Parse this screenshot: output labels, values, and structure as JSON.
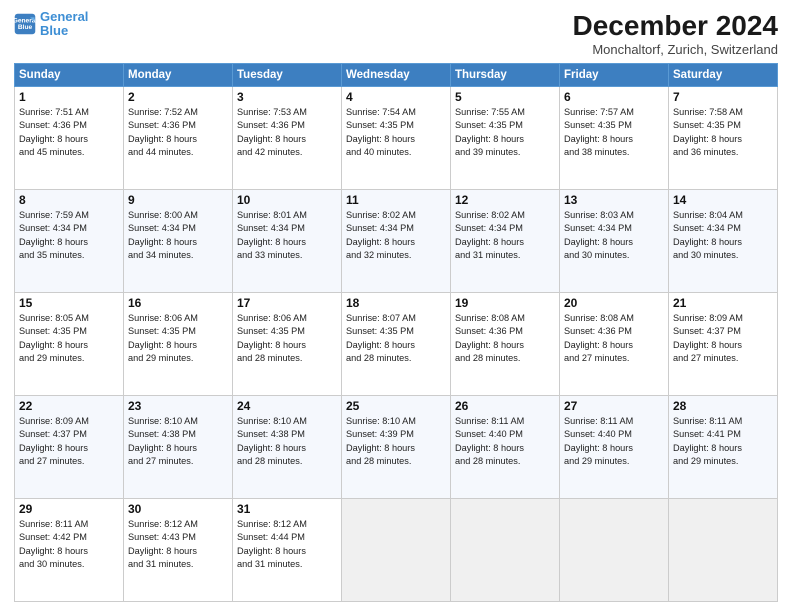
{
  "logo": {
    "line1": "General",
    "line2": "Blue"
  },
  "title": "December 2024",
  "location": "Monchaltorf, Zurich, Switzerland",
  "days_of_week": [
    "Sunday",
    "Monday",
    "Tuesday",
    "Wednesday",
    "Thursday",
    "Friday",
    "Saturday"
  ],
  "weeks": [
    [
      {
        "day": "1",
        "sunrise": "7:51 AM",
        "sunset": "4:36 PM",
        "daylight": "8 hours and 45 minutes."
      },
      {
        "day": "2",
        "sunrise": "7:52 AM",
        "sunset": "4:36 PM",
        "daylight": "8 hours and 44 minutes."
      },
      {
        "day": "3",
        "sunrise": "7:53 AM",
        "sunset": "4:36 PM",
        "daylight": "8 hours and 42 minutes."
      },
      {
        "day": "4",
        "sunrise": "7:54 AM",
        "sunset": "4:35 PM",
        "daylight": "8 hours and 40 minutes."
      },
      {
        "day": "5",
        "sunrise": "7:55 AM",
        "sunset": "4:35 PM",
        "daylight": "8 hours and 39 minutes."
      },
      {
        "day": "6",
        "sunrise": "7:57 AM",
        "sunset": "4:35 PM",
        "daylight": "8 hours and 38 minutes."
      },
      {
        "day": "7",
        "sunrise": "7:58 AM",
        "sunset": "4:35 PM",
        "daylight": "8 hours and 36 minutes."
      }
    ],
    [
      {
        "day": "8",
        "sunrise": "7:59 AM",
        "sunset": "4:34 PM",
        "daylight": "8 hours and 35 minutes."
      },
      {
        "day": "9",
        "sunrise": "8:00 AM",
        "sunset": "4:34 PM",
        "daylight": "8 hours and 34 minutes."
      },
      {
        "day": "10",
        "sunrise": "8:01 AM",
        "sunset": "4:34 PM",
        "daylight": "8 hours and 33 minutes."
      },
      {
        "day": "11",
        "sunrise": "8:02 AM",
        "sunset": "4:34 PM",
        "daylight": "8 hours and 32 minutes."
      },
      {
        "day": "12",
        "sunrise": "8:02 AM",
        "sunset": "4:34 PM",
        "daylight": "8 hours and 31 minutes."
      },
      {
        "day": "13",
        "sunrise": "8:03 AM",
        "sunset": "4:34 PM",
        "daylight": "8 hours and 30 minutes."
      },
      {
        "day": "14",
        "sunrise": "8:04 AM",
        "sunset": "4:34 PM",
        "daylight": "8 hours and 30 minutes."
      }
    ],
    [
      {
        "day": "15",
        "sunrise": "8:05 AM",
        "sunset": "4:35 PM",
        "daylight": "8 hours and 29 minutes."
      },
      {
        "day": "16",
        "sunrise": "8:06 AM",
        "sunset": "4:35 PM",
        "daylight": "8 hours and 29 minutes."
      },
      {
        "day": "17",
        "sunrise": "8:06 AM",
        "sunset": "4:35 PM",
        "daylight": "8 hours and 28 minutes."
      },
      {
        "day": "18",
        "sunrise": "8:07 AM",
        "sunset": "4:35 PM",
        "daylight": "8 hours and 28 minutes."
      },
      {
        "day": "19",
        "sunrise": "8:08 AM",
        "sunset": "4:36 PM",
        "daylight": "8 hours and 28 minutes."
      },
      {
        "day": "20",
        "sunrise": "8:08 AM",
        "sunset": "4:36 PM",
        "daylight": "8 hours and 27 minutes."
      },
      {
        "day": "21",
        "sunrise": "8:09 AM",
        "sunset": "4:37 PM",
        "daylight": "8 hours and 27 minutes."
      }
    ],
    [
      {
        "day": "22",
        "sunrise": "8:09 AM",
        "sunset": "4:37 PM",
        "daylight": "8 hours and 27 minutes."
      },
      {
        "day": "23",
        "sunrise": "8:10 AM",
        "sunset": "4:38 PM",
        "daylight": "8 hours and 27 minutes."
      },
      {
        "day": "24",
        "sunrise": "8:10 AM",
        "sunset": "4:38 PM",
        "daylight": "8 hours and 28 minutes."
      },
      {
        "day": "25",
        "sunrise": "8:10 AM",
        "sunset": "4:39 PM",
        "daylight": "8 hours and 28 minutes."
      },
      {
        "day": "26",
        "sunrise": "8:11 AM",
        "sunset": "4:40 PM",
        "daylight": "8 hours and 28 minutes."
      },
      {
        "day": "27",
        "sunrise": "8:11 AM",
        "sunset": "4:40 PM",
        "daylight": "8 hours and 29 minutes."
      },
      {
        "day": "28",
        "sunrise": "8:11 AM",
        "sunset": "4:41 PM",
        "daylight": "8 hours and 29 minutes."
      }
    ],
    [
      {
        "day": "29",
        "sunrise": "8:11 AM",
        "sunset": "4:42 PM",
        "daylight": "8 hours and 30 minutes."
      },
      {
        "day": "30",
        "sunrise": "8:12 AM",
        "sunset": "4:43 PM",
        "daylight": "8 hours and 31 minutes."
      },
      {
        "day": "31",
        "sunrise": "8:12 AM",
        "sunset": "4:44 PM",
        "daylight": "8 hours and 31 minutes."
      },
      null,
      null,
      null,
      null
    ]
  ],
  "labels": {
    "sunrise_prefix": "Sunrise: ",
    "sunset_prefix": "Sunset: ",
    "daylight_label": "Daylight: "
  }
}
